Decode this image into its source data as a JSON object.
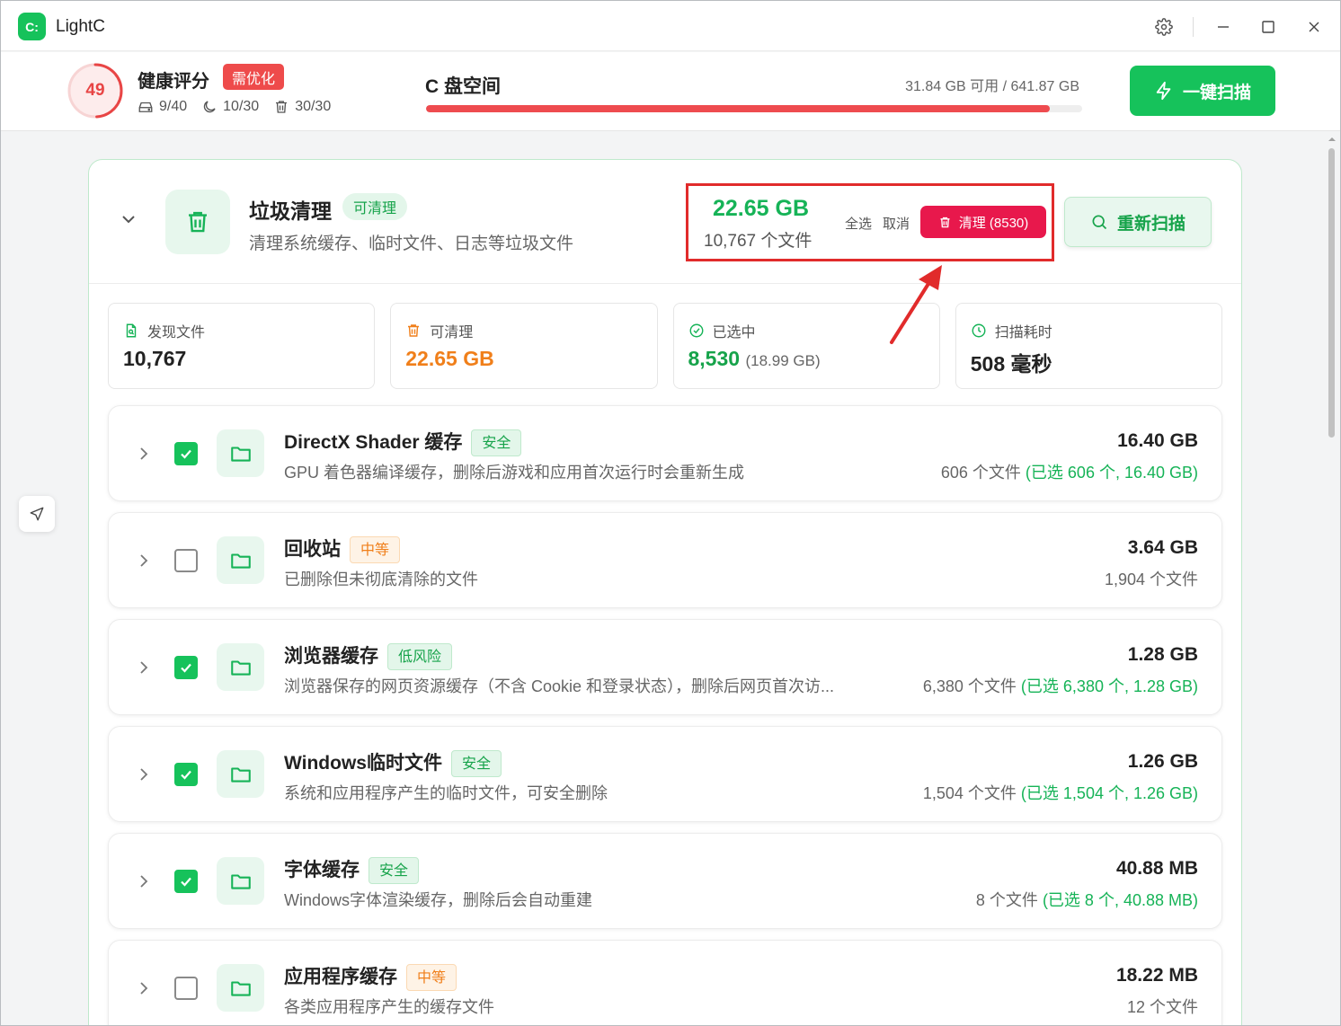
{
  "app": {
    "logo": "C:",
    "title": "LightC"
  },
  "window_controls": [
    "gear-icon",
    "minimize-icon",
    "maximize-icon",
    "close-icon"
  ],
  "health": {
    "score": "49",
    "label": "健康评分",
    "badge": "需优化",
    "stats": [
      {
        "icon": "drive-icon",
        "value": "9/40"
      },
      {
        "icon": "moon-icon",
        "value": "10/30"
      },
      {
        "icon": "trash-icon",
        "value": "30/30"
      }
    ]
  },
  "disk": {
    "label": "C 盘空间",
    "info": "31.84 GB 可用 / 641.87 GB",
    "used_fraction": 0.95
  },
  "toolbar": {
    "scan_label": "一键扫描"
  },
  "card": {
    "title": "垃圾清理",
    "badge": "可清理",
    "desc": "清理系统缓存、临时文件、日志等垃圾文件",
    "total_size": "22.65 GB",
    "total_files": "10,767 个文件",
    "select_all": "全选",
    "cancel": "取消",
    "clean_label": "清理 (8530)",
    "rescan_label": "重新扫描"
  },
  "stats": [
    {
      "icon": "file-search-icon",
      "label": "发现文件",
      "value": "10,767",
      "sub": "",
      "style": ""
    },
    {
      "icon": "trash-icon",
      "label": "可清理",
      "value": "22.65 GB",
      "sub": "",
      "style": "orange"
    },
    {
      "icon": "check-circle-icon",
      "label": "已选中",
      "value": "8,530",
      "sub": "(18.99 GB)",
      "style": "green"
    },
    {
      "icon": "clock-icon",
      "label": "扫描耗时",
      "value": "508 毫秒",
      "sub": "",
      "style": ""
    }
  ],
  "items": [
    {
      "title": "DirectX Shader 缓存",
      "risk": "安全",
      "risk_type": "safe",
      "checked": true,
      "desc": "GPU 着色器编译缓存，删除后游戏和应用首次运行时会重新生成",
      "size": "16.40 GB",
      "files": "606 个文件",
      "selected": "(已选 606 个, 16.40 GB)"
    },
    {
      "title": "回收站",
      "risk": "中等",
      "risk_type": "mid",
      "checked": false,
      "desc": "已删除但未彻底清除的文件",
      "size": "3.64 GB",
      "files": "1,904 个文件",
      "selected": ""
    },
    {
      "title": "浏览器缓存",
      "risk": "低风险",
      "risk_type": "low",
      "checked": true,
      "desc": "浏览器保存的网页资源缓存（不含 Cookie 和登录状态），删除后网页首次访...",
      "size": "1.28 GB",
      "files": "6,380 个文件",
      "selected": "(已选 6,380 个, 1.28 GB)"
    },
    {
      "title": "Windows临时文件",
      "risk": "安全",
      "risk_type": "safe",
      "checked": true,
      "desc": "系统和应用程序产生的临时文件，可安全删除",
      "size": "1.26 GB",
      "files": "1,504 个文件",
      "selected": "(已选 1,504 个, 1.26 GB)"
    },
    {
      "title": "字体缓存",
      "risk": "安全",
      "risk_type": "safe",
      "checked": true,
      "desc": "Windows字体渲染缓存，删除后会自动重建",
      "size": "40.88 MB",
      "files": "8 个文件",
      "selected": "(已选 8 个, 40.88 MB)"
    },
    {
      "title": "应用程序缓存",
      "risk": "中等",
      "risk_type": "mid",
      "checked": false,
      "desc": "各类应用程序产生的缓存文件",
      "size": "18.22 MB",
      "files": "12 个文件",
      "selected": ""
    }
  ],
  "colors": {
    "accent": "#16c25b",
    "danger": "#e8184c",
    "warning": "#f07f1a"
  }
}
